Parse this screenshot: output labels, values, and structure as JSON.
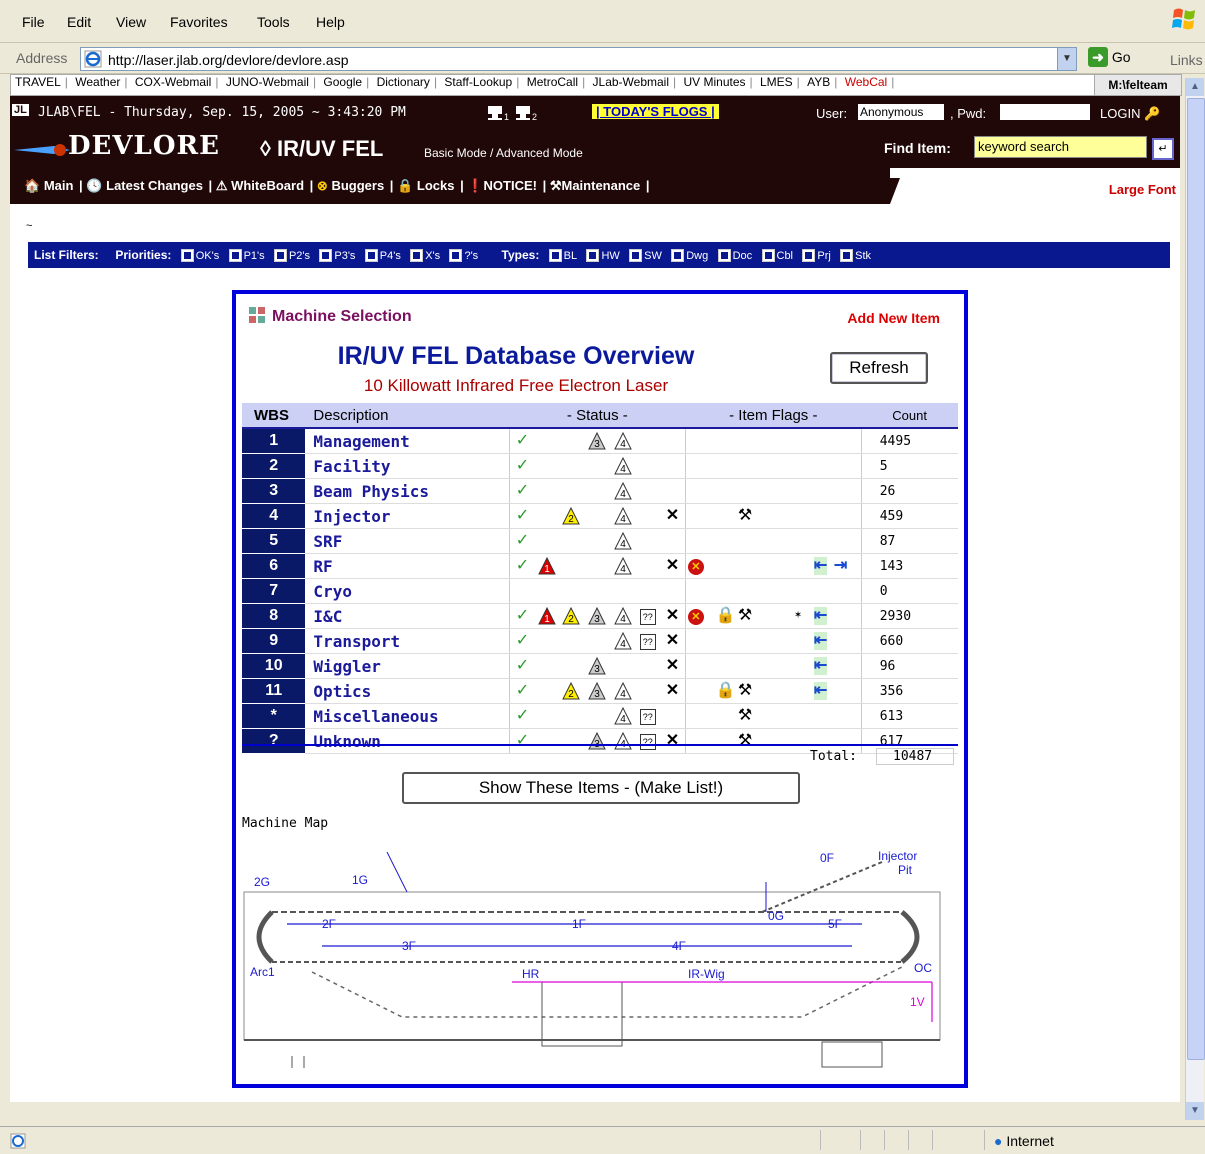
{
  "menu": [
    "File",
    "Edit",
    "View",
    "Favorites",
    "Tools",
    "Help"
  ],
  "address": {
    "label": "Address",
    "url": "http://laser.jlab.org/devlore/devlore.asp",
    "go": "Go",
    "links": "Links"
  },
  "linksbar": {
    "items": [
      "TRAVEL",
      "Weather",
      "COX-Webmail",
      "JUNO-Webmail",
      "Google",
      "Dictionary",
      "Staff-Lookup",
      "MetroCall",
      "JLab-Webmail",
      "UV Minutes",
      "LMES",
      "AYB",
      "WebCal"
    ],
    "drive": "M:\\felteam"
  },
  "header": {
    "jl": "JL",
    "site_line": "JLAB\\FEL - Thursday, Sep. 15, 2005 ~ 3:43:20 PM",
    "flogs": "| TODAY'S FLOGS |",
    "user_label": "User:",
    "user_value": "Anonymous",
    "pwd_label": ", Pwd:",
    "login": "LOGIN",
    "devlore": "DEVLORE",
    "machine": "◊ IR/UV FEL",
    "modes": "Basic Mode / Advanced Mode",
    "find_label": "Find Item:",
    "search_placeholder": "keyword search",
    "large_font": "Large Font"
  },
  "nav": [
    "Main",
    "Latest Changes",
    "WhiteBoard",
    "Buggers",
    "Locks",
    "NOTICE!",
    "Maintenance"
  ],
  "filters": {
    "label": "List Filters:",
    "priorities_label": "Priorities:",
    "priorities": [
      "OK's",
      "P1's",
      "P2's",
      "P3's",
      "P4's",
      "X's",
      "?'s"
    ],
    "types_label": "Types:",
    "types": [
      "BL",
      "HW",
      "SW",
      "Dwg",
      "Doc",
      "Cbl",
      "Prj",
      "Stk"
    ]
  },
  "panel": {
    "machine_selection": "Machine Selection",
    "add_new": "Add New Item",
    "title": "IR/UV FEL Database Overview",
    "subtitle": "10 Killowatt Infrared Free Electron Laser",
    "refresh": "Refresh",
    "headers": {
      "wbs": "WBS",
      "desc": "Description",
      "status": "- Status -",
      "flags": "- Item Flags -",
      "count": "Count"
    },
    "total_label": "Total:",
    "total": "10487",
    "show_button": "Show These Items - (Make List!)",
    "map_label": "Machine Map"
  },
  "rows": [
    {
      "wbs": "1",
      "desc": "Management",
      "count": "4495",
      "status": [
        "ok",
        "p3",
        "p4"
      ],
      "flags": []
    },
    {
      "wbs": "2",
      "desc": "Facility",
      "count": "5",
      "status": [
        "ok",
        "p4"
      ],
      "flags": []
    },
    {
      "wbs": "3",
      "desc": "Beam Physics",
      "count": "26",
      "status": [
        "ok",
        "p4"
      ],
      "flags": []
    },
    {
      "wbs": "4",
      "desc": "Injector",
      "count": "459",
      "status": [
        "ok",
        "p2",
        "p4",
        "x"
      ],
      "flags": [
        "maint"
      ]
    },
    {
      "wbs": "5",
      "desc": "SRF",
      "count": "87",
      "status": [
        "ok",
        "p4"
      ],
      "flags": []
    },
    {
      "wbs": "6",
      "desc": "RF",
      "count": "143",
      "status": [
        "ok",
        "p1",
        "p4",
        "x"
      ],
      "flags": [
        "bug",
        "wb1",
        "wb2"
      ]
    },
    {
      "wbs": "7",
      "desc": "Cryo",
      "count": "0",
      "status": [],
      "flags": []
    },
    {
      "wbs": "8",
      "desc": "I&C",
      "count": "2930",
      "status": [
        "ok",
        "p1",
        "p2",
        "p3",
        "p4",
        "q",
        "x"
      ],
      "flags": [
        "bug",
        "lock",
        "maint",
        "star",
        "wb1"
      ]
    },
    {
      "wbs": "9",
      "desc": "Transport",
      "count": "660",
      "status": [
        "ok",
        "p4",
        "q",
        "x"
      ],
      "flags": [
        "wb1"
      ]
    },
    {
      "wbs": "10",
      "desc": "Wiggler",
      "count": "96",
      "status": [
        "ok",
        "p3",
        "x"
      ],
      "flags": [
        "wb1"
      ]
    },
    {
      "wbs": "11",
      "desc": "Optics",
      "count": "356",
      "status": [
        "ok",
        "p2",
        "p3",
        "p4",
        "x"
      ],
      "flags": [
        "lock",
        "maint",
        "wb1"
      ]
    },
    {
      "wbs": "*",
      "desc": "Miscellaneous",
      "count": "613",
      "status": [
        "ok",
        "p4",
        "q"
      ],
      "flags": [
        "maint"
      ]
    },
    {
      "wbs": "?",
      "desc": "Unknown",
      "count": "617",
      "status": [
        "ok",
        "p3",
        "p4",
        "q",
        "x"
      ],
      "flags": [
        "maint"
      ]
    }
  ],
  "map_labels": {
    "g2": "2G",
    "g1": "1G",
    "f0": "0F",
    "injector": "Injector",
    "pit": "Pit",
    "g0": "0G",
    "f1": "1F",
    "f2": "2F",
    "f3": "3F",
    "f4": "4F",
    "f5": "5F",
    "arc1": "Arc1",
    "hr": "HR",
    "irwig": "IR-Wig",
    "oc": "OC",
    "v1": "1V"
  },
  "status_bar": {
    "zone": "Internet"
  },
  "colors": {
    "header_bg": "#200808",
    "filter_bg": "#0a1890",
    "panel_border": "#0000dd",
    "wbs_bg": "#0a1868",
    "title": "#0a1a9a",
    "subtitle": "#aa0000",
    "flogs_bg": "#ffff33"
  }
}
